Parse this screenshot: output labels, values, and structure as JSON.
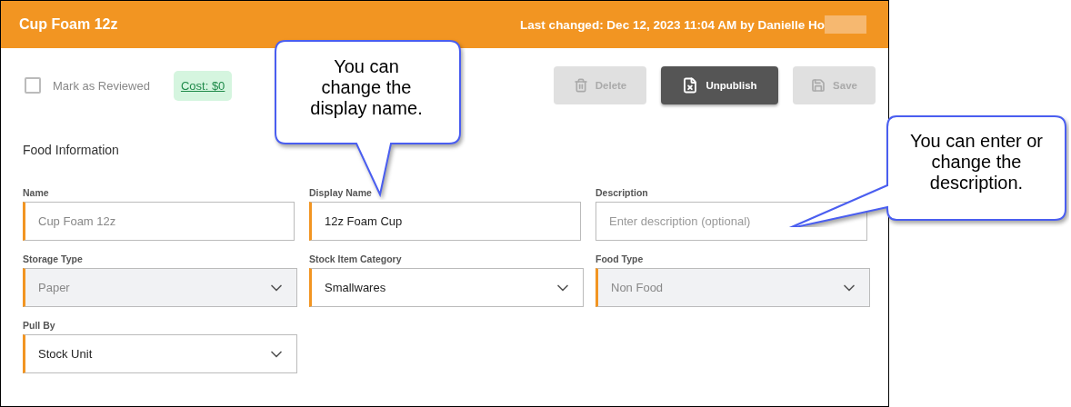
{
  "header": {
    "title": "Cup Foam 12z",
    "last_changed": "Last changed: Dec 12, 2023 11:04 AM by Danielle Ho"
  },
  "reviewed": {
    "label": "Mark as Reviewed",
    "checked": false
  },
  "cost": "Cost: $0",
  "buttons": [
    {
      "label": "Delete",
      "kind": "delete",
      "disabled": true
    },
    {
      "label": "Unpublish",
      "kind": "unpublish",
      "disabled": false
    },
    {
      "label": "Save",
      "kind": "save",
      "disabled": true
    }
  ],
  "section_title": "Food Information",
  "fields": [
    {
      "label": "Name",
      "kind": "input",
      "value": "Cup Foam 12z",
      "required": true,
      "disabled": true
    },
    {
      "label": "Display Name",
      "kind": "input",
      "value": "12z Foam Cup",
      "required": true,
      "disabled": false
    },
    {
      "label": "Description",
      "kind": "input",
      "placeholder": "Enter description (optional)",
      "required": false
    },
    {
      "label": "Storage Type",
      "kind": "select",
      "value": "Paper",
      "required": true,
      "disabled": true
    },
    {
      "label": "Stock Item Category",
      "kind": "select",
      "value": "Smallwares",
      "required": true,
      "disabled": false
    },
    {
      "label": "Food Type",
      "kind": "select",
      "value": "Non Food",
      "required": true,
      "disabled": true
    },
    {
      "label": "Pull By",
      "kind": "select",
      "value": "Stock Unit",
      "required": true,
      "disabled": false
    }
  ],
  "callouts": [
    {
      "text": "You can change the display name.",
      "kind": "down"
    },
    {
      "text": "You can enter or change the description.",
      "kind": "left"
    }
  ]
}
